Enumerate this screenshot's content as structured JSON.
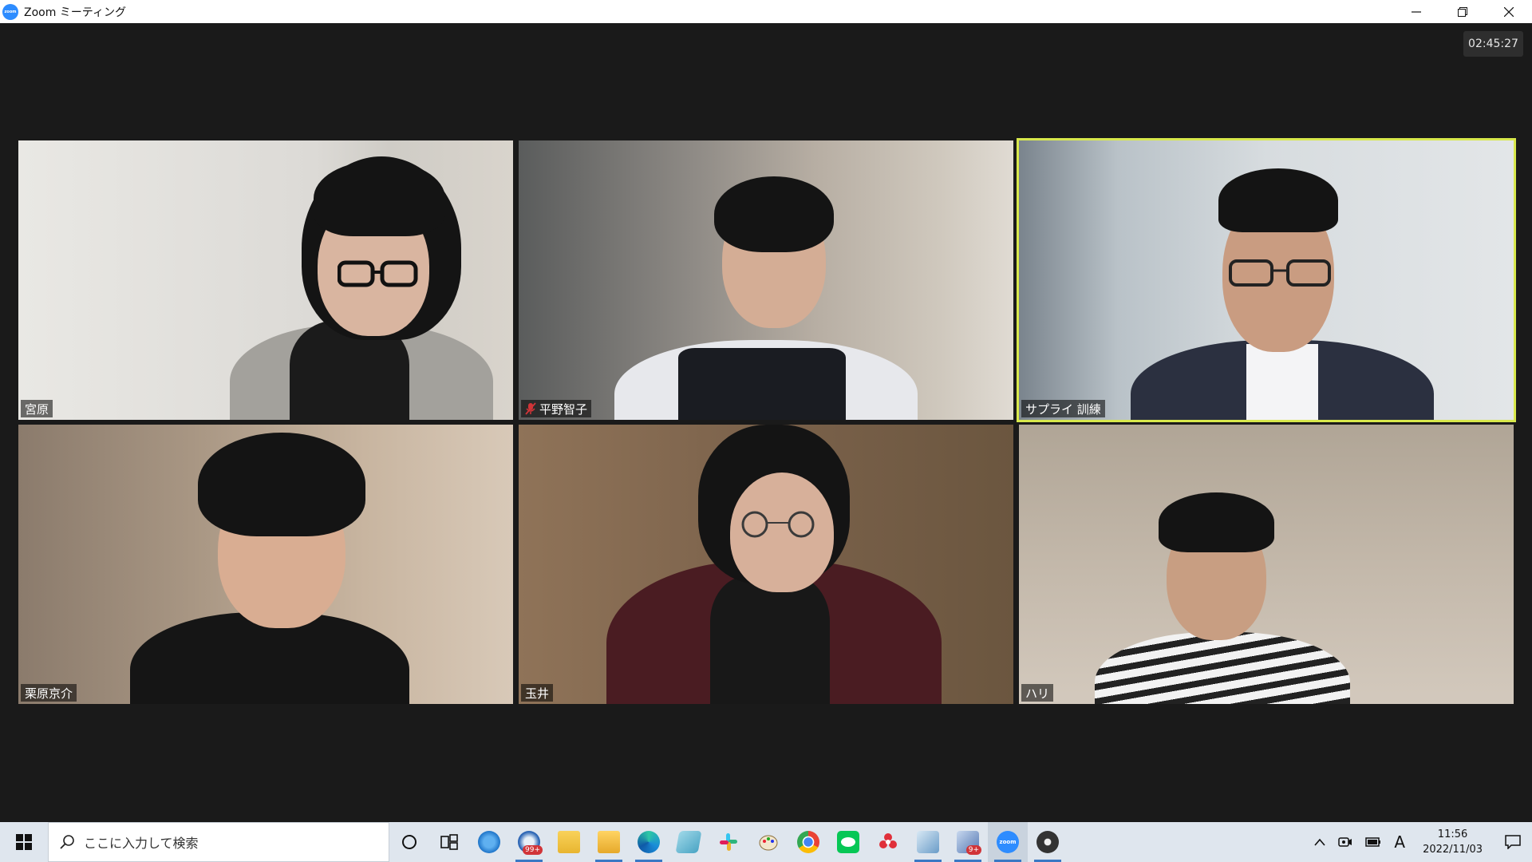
{
  "window": {
    "title": "Zoom ミーティング"
  },
  "meeting": {
    "timer": "02:45:27",
    "participants": [
      {
        "name": "宮原",
        "muted": false,
        "active": false
      },
      {
        "name": "平野智子",
        "muted": true,
        "active": false
      },
      {
        "name": "サプライ 訓練",
        "muted": false,
        "active": true
      },
      {
        "name": "栗原京介",
        "muted": false,
        "active": false
      },
      {
        "name": "玉井",
        "muted": false,
        "active": false
      },
      {
        "name": "ハリ",
        "muted": false,
        "active": false
      }
    ]
  },
  "taskbar": {
    "search_placeholder": "ここに入力して検索",
    "apps": [
      {
        "icon": "cortana-icon"
      },
      {
        "icon": "task-view-icon"
      },
      {
        "icon": "internet-explorer-icon"
      },
      {
        "icon": "thunderbird-icon",
        "badge": "99+"
      },
      {
        "icon": "onedrive-folder-icon"
      },
      {
        "icon": "file-explorer-icon"
      },
      {
        "icon": "edge-icon"
      },
      {
        "icon": "notepad-icon"
      },
      {
        "icon": "slack-icon"
      },
      {
        "icon": "paint-icon"
      },
      {
        "icon": "chrome-icon"
      },
      {
        "icon": "line-icon"
      },
      {
        "icon": "flower-app-icon"
      },
      {
        "icon": "network-tool-icon"
      },
      {
        "icon": "remote-tool-icon",
        "badge": "9+"
      },
      {
        "icon": "zoom-icon"
      },
      {
        "icon": "davinci-icon"
      }
    ],
    "ime": "A",
    "clock_time": "11:56",
    "clock_date": "2022/11/03"
  },
  "colors": {
    "active_speaker": "#D8E84C",
    "zoom_blue": "#2D8CFF",
    "meeting_bg": "#1a1a1a",
    "taskbar_bg": "#dfe6ee"
  }
}
